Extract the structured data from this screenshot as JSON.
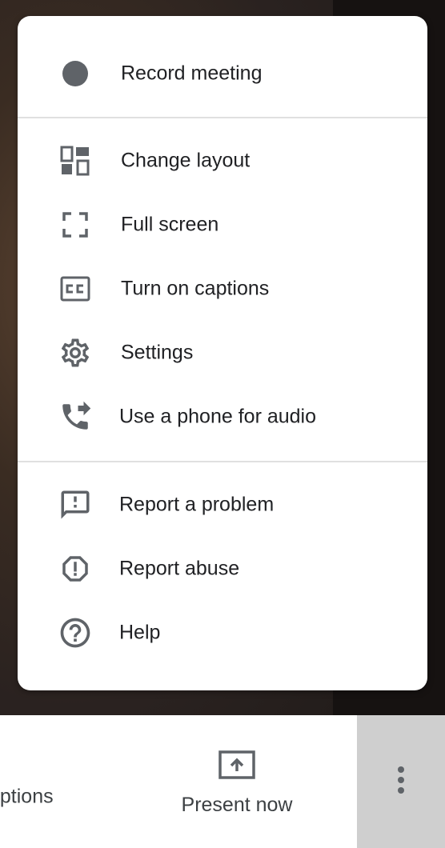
{
  "menu": {
    "record": {
      "label": "Record meeting",
      "icon": "record-dot-icon"
    },
    "view_items": [
      {
        "label": "Change layout",
        "icon": "layout-icon"
      },
      {
        "label": "Full screen",
        "icon": "fullscreen-icon"
      },
      {
        "label": "Turn on captions",
        "icon": "closed-captions-icon"
      },
      {
        "label": "Settings",
        "icon": "gear-icon"
      },
      {
        "label": "Use a phone for audio",
        "icon": "phone-forward-icon"
      }
    ],
    "support_items": [
      {
        "label": "Report a problem",
        "icon": "feedback-icon"
      },
      {
        "label": "Report abuse",
        "icon": "report-octagon-icon"
      },
      {
        "label": "Help",
        "icon": "help-circle-icon"
      }
    ]
  },
  "bottom_bar": {
    "captions_label": "aptions",
    "present_label": "Present now",
    "more_icon": "more-vert-icon"
  },
  "colors": {
    "icon": "#5f6368",
    "text": "#202124",
    "menu_bg": "#ffffff",
    "more_button_bg": "#cfcfcf"
  }
}
